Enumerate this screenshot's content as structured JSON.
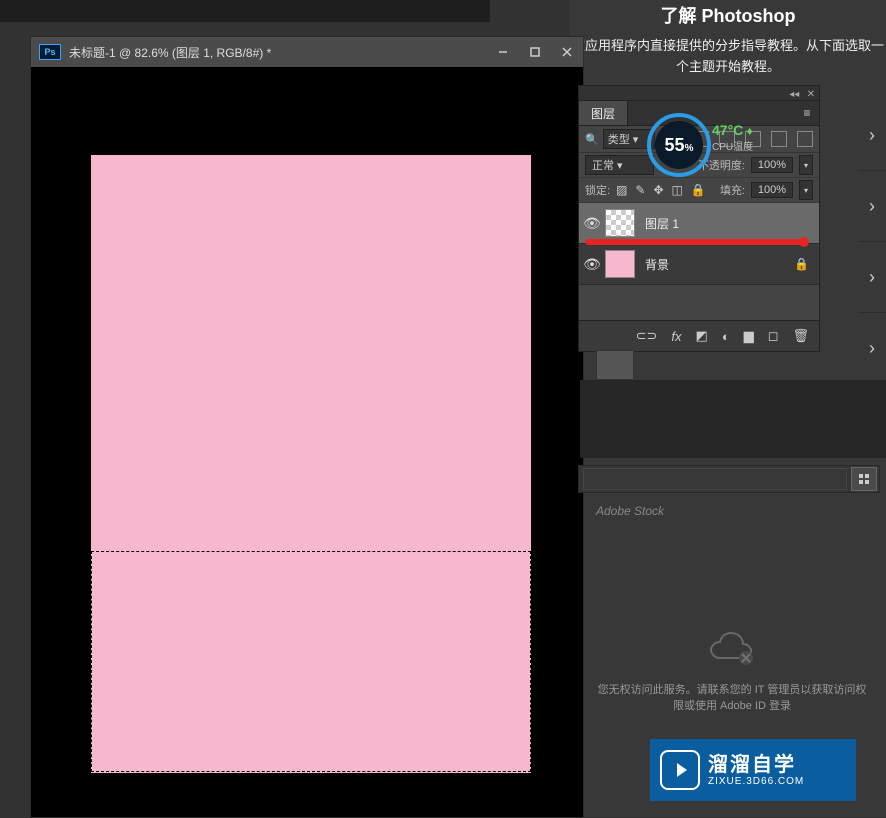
{
  "learn": {
    "title": "了解 Photoshop",
    "subtitle": "在应用程序内直接提供的分步指导教程。从下面选取一个主题开始教程。"
  },
  "document": {
    "ps_badge": "Ps",
    "title": "未标题-1 @ 82.6% (图层 1, RGB/8#) *"
  },
  "gauge": {
    "percent": "55",
    "percent_unit": "%",
    "temp": "47°C",
    "temp_label": "CPU温度"
  },
  "layers_panel": {
    "tab": "图层",
    "filter_search": "🔍",
    "filter_label": "类型",
    "blend_mode": "正常",
    "opacity_label": "不透明度:",
    "opacity_value": "100%",
    "lock_label": "锁定:",
    "fill_label": "填充:",
    "fill_value": "100%",
    "layers": [
      {
        "name": "图层 1",
        "locked": false
      },
      {
        "name": "背景",
        "locked": true
      }
    ]
  },
  "stock": {
    "label": "Adobe Stock"
  },
  "cloud": {
    "message": "您无权访问此服务。请联系您的 IT 管理员以获取访问权限或使用 Adobe ID 登录"
  },
  "watermark": {
    "big": "溜溜自学",
    "small": "ZIXUE.3D66.COM"
  }
}
